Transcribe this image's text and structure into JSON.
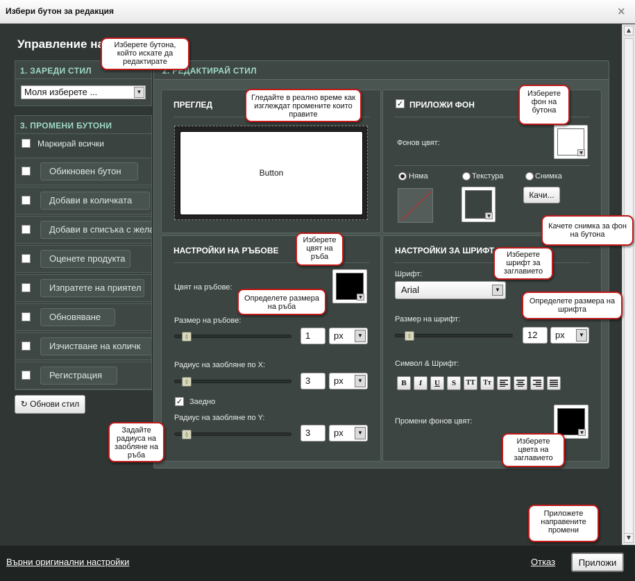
{
  "window": {
    "title": "Избери бутон за редакция",
    "close_label": "×"
  },
  "heading": "Управление на",
  "left": {
    "section1_title": "1. ЗАРЕДИ СТИЛ",
    "style_select": {
      "value": "Моля изберете ..."
    },
    "section3_title": "3. ПРОМЕНИ БУТОНИ",
    "mark_all_label": "Маркирай всички",
    "buttons": [
      {
        "label": "Обикновен бутон"
      },
      {
        "label": "Добави в количката"
      },
      {
        "label": "Добави в списъка с жела"
      },
      {
        "label": "Оценете продукта"
      },
      {
        "label": "Изпратете на приятел"
      },
      {
        "label": "Обновяване"
      },
      {
        "label": "Изчистване на количк"
      },
      {
        "label": "Регистрация"
      }
    ],
    "update_button": {
      "icon": "refresh-icon",
      "label": "Обнови стил"
    }
  },
  "edit": {
    "section2_title": "2. РЕДАКТИРАЙ СТИЛ",
    "preview": {
      "title": "ПРЕГЛЕД",
      "button_label": "Button"
    },
    "background": {
      "title": "ПРИЛОЖИ ФОН",
      "color_label": "Фонов цвят:",
      "options": [
        {
          "label": "Няма",
          "selected": true
        },
        {
          "label": "Текстура",
          "selected": false
        },
        {
          "label": "Снимка",
          "selected": false
        }
      ],
      "upload_label": "Качи..."
    },
    "border": {
      "title": "НАСТРОЙКИ НА РЪБОВЕ",
      "color_label": "Цвят на ръбове:",
      "size_label": "Размер на ръбове:",
      "size_value": "1",
      "size_unit": "px",
      "radius_x_label": "Радиус на заобляне по X:",
      "radius_x_value": "3",
      "radius_x_unit": "px",
      "together_label": "Заедно",
      "radius_y_label": "Радиус на заобляне по Y:",
      "radius_y_value": "3",
      "radius_y_unit": "px"
    },
    "font": {
      "title": "НАСТРОЙКИ ЗА ШРИФТ Н",
      "font_label": "Шрифт:",
      "font_value": "Arial",
      "size_label": "Размер на шрифт:",
      "size_value": "12",
      "size_unit": "px",
      "symbol_label": "Символ & Шрифт:",
      "format_buttons": [
        "B",
        "I",
        "U",
        "S",
        "TT",
        "Tт"
      ],
      "bg_color_label": "Промени фонов цвят:"
    }
  },
  "tooltips": {
    "select_button": "Изберете бутона, който искате да редактирате",
    "preview": "Гледайте в реално време как изглеждат промените които правите",
    "bg_color": "Изберете фон на бутона",
    "upload": "Качете снимка за фон на бутона",
    "border_color": "Изберете цвят на ръба",
    "border_size": "Определете размера на ръба",
    "font": "Изберете шрифт за заглавието",
    "font_size": "Определете размера на шрифта",
    "radius": "Задайте радиуса на заобляне на ръба",
    "font_color": "Изберете цвета на заглавието",
    "apply": "Приложете направените промени"
  },
  "footer": {
    "reset_label": "Върни оригинални настройки",
    "cancel_label": "Отказ",
    "apply_label": "Приложи"
  },
  "colors": {
    "accent": "#9fd8c6",
    "tooltip_border": "#c21a1a"
  }
}
